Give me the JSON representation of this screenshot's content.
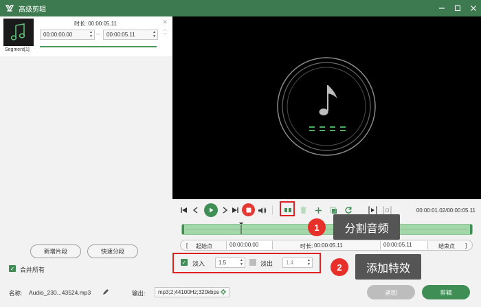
{
  "window": {
    "title": "高级剪辑",
    "controls": [
      "minimize-icon",
      "maximize-icon",
      "close-icon"
    ]
  },
  "segment": {
    "duration_label": "时长:",
    "duration_value": "00:00:05.11",
    "start_time": "00:00:00.00",
    "end_time": "00:00:05.11",
    "separator": "--",
    "label": "Segment[1]"
  },
  "left_actions": {
    "add_segment": "新增片段",
    "quick_split": "快速分段",
    "merge_all": "合并所有"
  },
  "player": {
    "time_readout": "00:00:01.02/00:00:05.11"
  },
  "selection": {
    "start_bracket": "[",
    "start_label": "起始点",
    "start_value": "00:00:00.00",
    "duration_label": "时长:",
    "duration_value": "00:00:05.11",
    "end_value": "00:00:05.11",
    "end_label": "结束点",
    "end_bracket": "]"
  },
  "fade": {
    "fade_in_label": "淡入",
    "fade_in_value": "1.5",
    "fade_out_label": "淡出",
    "fade_out_value": "1.4"
  },
  "callouts": [
    {
      "number": "1",
      "label": "分割音频"
    },
    {
      "number": "2",
      "label": "添加特效"
    }
  ],
  "bottom": {
    "name_label": "名称:",
    "name_value": "Audio_230...43524.mp3",
    "output_label": "输出:",
    "output_value": "mp3;2;44100Hz;320kbps",
    "return_label": "返回",
    "cut_label": "剪辑"
  },
  "colors": {
    "brand_green": "#3d7a4f",
    "accent_green": "#3e8e55",
    "track_green": "#a3d6a9",
    "highlight_red": "#e02020"
  }
}
